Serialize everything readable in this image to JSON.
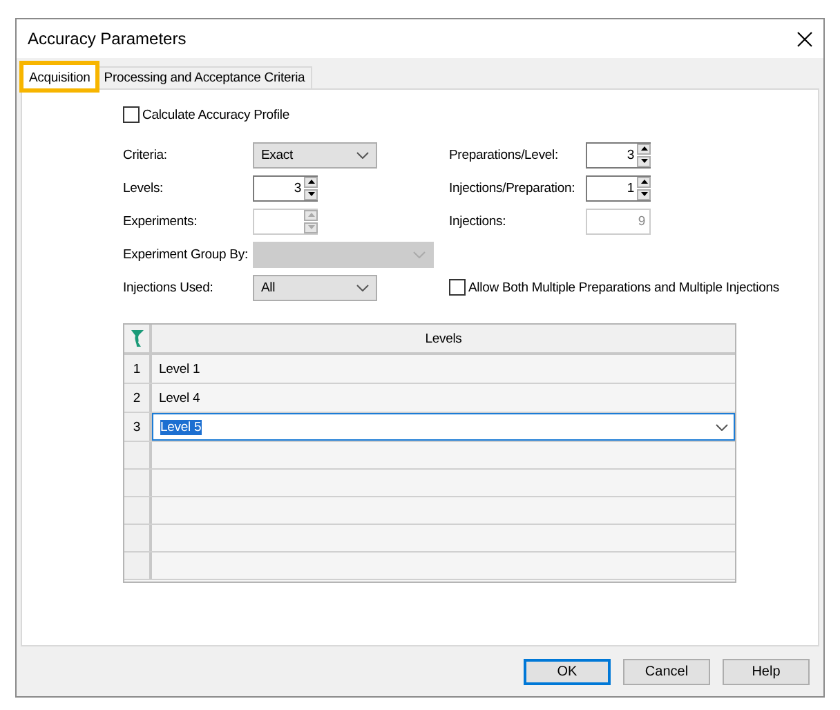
{
  "window": {
    "title": "Accuracy Parameters"
  },
  "tabs": [
    {
      "label": "Acquisition",
      "selected": true,
      "highlighted": true
    },
    {
      "label": "Processing and Acceptance Criteria",
      "selected": false,
      "highlighted": false
    }
  ],
  "profile_checkbox": {
    "label": "Calculate Accuracy Profile",
    "checked": false
  },
  "form_rows": [
    {
      "left": {
        "kind": "combo",
        "label": "Criteria:",
        "value": "Exact",
        "disabled": false
      },
      "right": {
        "kind": "spin",
        "label": "Preparations/Level:",
        "value": "3",
        "disabled": false
      }
    },
    {
      "left": {
        "kind": "spin",
        "label": "Levels:",
        "value": "3",
        "disabled": false
      },
      "right": {
        "kind": "spin",
        "label": "Injections/Preparation:",
        "value": "1",
        "disabled": false
      }
    },
    {
      "left": {
        "kind": "spin",
        "label": "Experiments:",
        "disabled": true
      },
      "right": {
        "kind": "text",
        "label": "Injections:",
        "value": "9",
        "disabled": true
      }
    },
    {
      "left": {
        "kind": "combo",
        "label": "Experiment Group By:",
        "disabled": true
      }
    },
    {
      "left": {
        "kind": "combo",
        "label": "Injections Used:",
        "value": "All",
        "disabled": false
      },
      "right": {
        "kind": "checkbox",
        "label": "Allow Both Multiple Preparations and Multiple Injections",
        "checked": false
      }
    }
  ],
  "grid": {
    "header": "Levels",
    "rows": [
      {
        "number": "1",
        "value": "Level 1",
        "editing": false
      },
      {
        "number": "2",
        "value": "Level 4",
        "editing": false
      },
      {
        "number": "3",
        "value": "Level 5",
        "editing": true
      }
    ]
  },
  "buttons": [
    {
      "label": "OK",
      "default": true
    },
    {
      "label": "Cancel",
      "default": false
    },
    {
      "label": "Help",
      "default": false
    }
  ]
}
